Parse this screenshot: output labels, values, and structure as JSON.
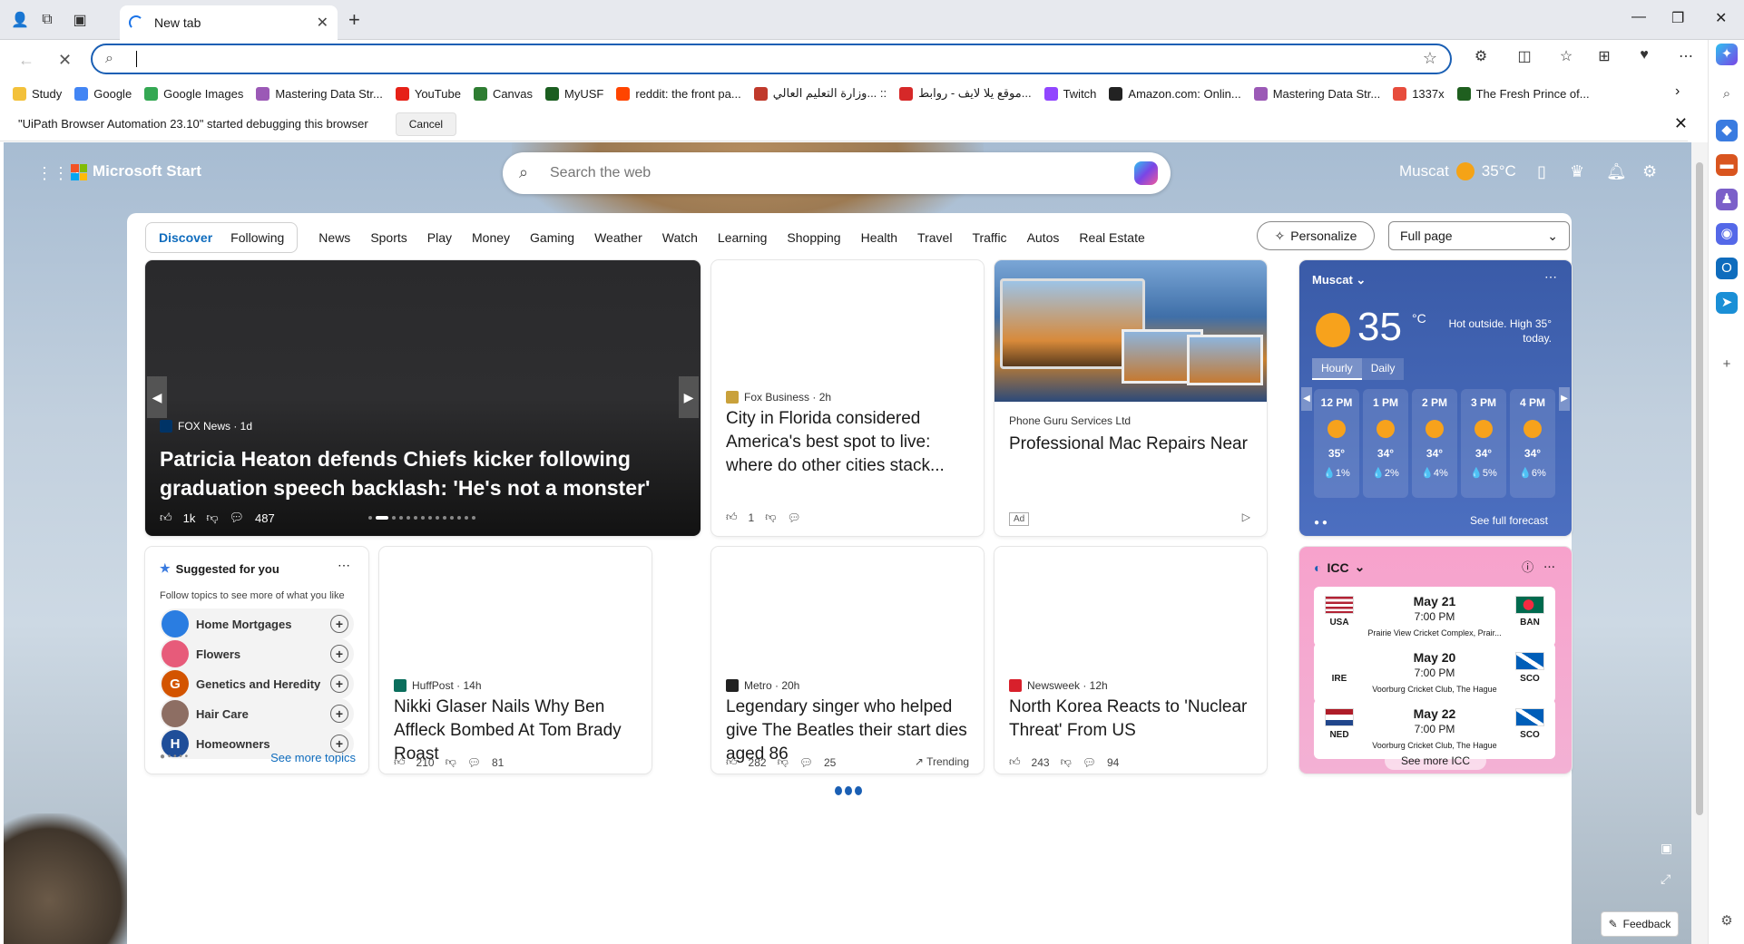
{
  "tabbar": {
    "tab_title": "New tab",
    "close": "✕",
    "new_tab": "+",
    "win_min": "—",
    "win_max": "❐",
    "win_close": "✕"
  },
  "omnibox": {
    "value": "",
    "placeholder": ""
  },
  "bookmarks": [
    {
      "label": "Study",
      "color": "#f3c13a"
    },
    {
      "label": "Google",
      "color": "#4285f4"
    },
    {
      "label": "Google Images",
      "color": "#34a853"
    },
    {
      "label": "Mastering Data Str...",
      "color": "#9b59b6"
    },
    {
      "label": "YouTube",
      "color": "#e62117"
    },
    {
      "label": "Canvas",
      "color": "#2e7d32"
    },
    {
      "label": "MyUSF",
      "color": "#1b5e20"
    },
    {
      "label": "reddit: the front pa...",
      "color": "#ff4500"
    },
    {
      "label": "وزارة التعليم العالي... ::",
      "color": "#c0392b"
    },
    {
      "label": "موقع يلا لايف - روابط...",
      "color": "#d62828"
    },
    {
      "label": "Twitch",
      "color": "#9146ff"
    },
    {
      "label": "Amazon.com: Onlin...",
      "color": "#222222"
    },
    {
      "label": "Mastering Data Str...",
      "color": "#9b59b6"
    },
    {
      "label": "1337x",
      "color": "#e74c3c"
    },
    {
      "label": "The Fresh Prince of...",
      "color": "#1f5f1f"
    }
  ],
  "infobar": {
    "message": "\"UiPath Browser Automation 23.10\" started debugging this browser",
    "cancel": "Cancel",
    "close": "✕"
  },
  "ms": {
    "brand": "Microsoft Start",
    "search_placeholder": "Search the web",
    "city": "Muscat",
    "temp": "35°C"
  },
  "nav": {
    "seg_discover": "Discover",
    "seg_following": "Following",
    "items": [
      "News",
      "Sports",
      "Play",
      "Money",
      "Gaming",
      "Weather",
      "Watch",
      "Learning",
      "Shopping",
      "Health",
      "Travel",
      "Traffic",
      "Autos",
      "Real Estate"
    ],
    "personalize": "Personalize",
    "layout": "Full page"
  },
  "hero": {
    "source": "FOX News · 1d",
    "title": "Patricia Heaton defends Chiefs kicker following graduation speech backlash: 'He's not a monster'",
    "likes": "1k",
    "comments": "487"
  },
  "fox_business": {
    "source": "Fox Business · 2h",
    "title": "City in Florida considered America's best spot to live: where do other cities stack...",
    "likes": "1"
  },
  "ad": {
    "source": "Phone Guru Services Ltd",
    "title": "Professional Mac Repairs Near",
    "badge": "Ad"
  },
  "weather": {
    "city": "Muscat",
    "temp": "35",
    "unit": "°C",
    "desc": "Hot outside. High 35° today.",
    "tab_hourly": "Hourly",
    "tab_daily": "Daily",
    "hours": [
      {
        "time": "12 PM",
        "temp": "35°",
        "precip": "💧1%"
      },
      {
        "time": "1 PM",
        "temp": "34°",
        "precip": "💧2%"
      },
      {
        "time": "2 PM",
        "temp": "34°",
        "precip": "💧4%"
      },
      {
        "time": "3 PM",
        "temp": "34°",
        "precip": "💧5%"
      },
      {
        "time": "4 PM",
        "temp": "34°",
        "precip": "💧6%"
      }
    ],
    "forecast_link": "See full forecast"
  },
  "suggested": {
    "title": "Suggested for you",
    "subtitle": "Follow topics to see more of what you like",
    "topics": [
      {
        "label": "Home Mortgages",
        "color": "#2a7de1",
        "initial": ""
      },
      {
        "label": "Flowers",
        "color": "#e75b7a",
        "initial": ""
      },
      {
        "label": "Genetics and Heredity",
        "color": "#d35400",
        "initial": "G"
      },
      {
        "label": "Hair Care",
        "color": "#8d6e63",
        "initial": ""
      },
      {
        "label": "Homeowners",
        "color": "#1f4e99",
        "initial": "H"
      }
    ],
    "see_more": "See more topics"
  },
  "huffpost": {
    "source": "HuffPost · 14h",
    "title": "Nikki Glaser Nails Why Ben Affleck Bombed At Tom Brady Roast",
    "likes": "210",
    "comments": "81"
  },
  "metro": {
    "source": "Metro · 20h",
    "title": "Legendary singer who helped give The Beatles their start dies aged 86",
    "likes": "282",
    "comments": "25",
    "trending": "Trending"
  },
  "newsweek": {
    "source": "Newsweek · 12h",
    "title": "North Korea Reacts to 'Nuclear Threat' From US",
    "likes": "243",
    "comments": "94"
  },
  "icc": {
    "title": "ICC",
    "matches": [
      {
        "date": "May 21",
        "time": "7:00 PM",
        "venue": "Prairie View Cricket Complex, Prair...",
        "home": "USA",
        "away": "BAN"
      },
      {
        "date": "May 20",
        "time": "7:00 PM",
        "venue": "Voorburg Cricket Club, The Hague",
        "home": "IRE",
        "away": "SCO"
      },
      {
        "date": "May 22",
        "time": "7:00 PM",
        "venue": "Voorburg Cricket Club, The Hague",
        "home": "NED",
        "away": "SCO"
      }
    ],
    "see_more": "See more ICC"
  },
  "feedback": "Feedback"
}
